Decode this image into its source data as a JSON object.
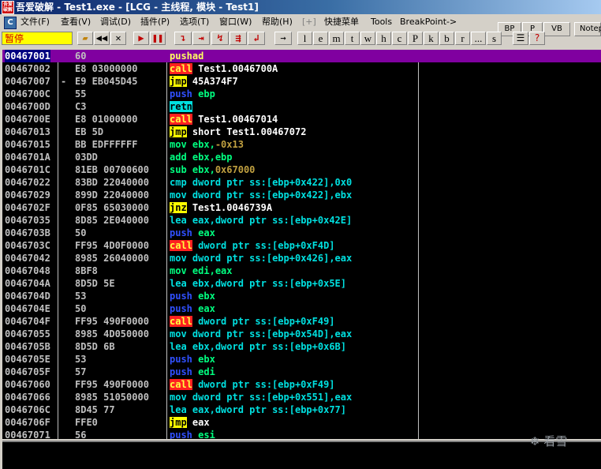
{
  "window": {
    "icon_text": "吾爱破解",
    "title": "吾爱破解 - Test1.exe - [LCG - 主线程, 模块 - Test1]"
  },
  "menu": [
    "文件(F)",
    "查看(V)",
    "调试(D)",
    "插件(P)",
    "选项(T)",
    "窗口(W)",
    "帮助(H)",
    "[+]",
    "快捷菜单",
    "Tools",
    "BreakPoint->"
  ],
  "right_buttons": [
    "BP",
    "P",
    "VB",
    "Notep"
  ],
  "status": "暂停",
  "toolbar_letters": [
    "l",
    "e",
    "m",
    "t",
    "w",
    "h",
    "c",
    "P",
    "k",
    "b",
    "r",
    "...",
    "s"
  ],
  "disasm": [
    {
      "addr": "00467001",
      "marker": "",
      "hex": "60",
      "mn": "pushad",
      "kind": "pushad",
      "op": "",
      "opkind": ""
    },
    {
      "addr": "00467002",
      "marker": "",
      "hex": "E8 03000000",
      "mn": "call",
      "kind": "call",
      "op": "Test1.0046700A",
      "opkind": "w"
    },
    {
      "addr": "00467007",
      "marker": "-",
      "hex": "E9 EB045D45",
      "mn": "jmp",
      "kind": "jmp",
      "op": "45A374F7",
      "opkind": "w"
    },
    {
      "addr": "0046700C",
      "marker": "",
      "hex": "55",
      "mn": "push",
      "kind": "push",
      "op": "ebp",
      "opkind": "c"
    },
    {
      "addr": "0046700D",
      "marker": "",
      "hex": "C3",
      "mn": "retn",
      "kind": "retn",
      "op": "",
      "opkind": ""
    },
    {
      "addr": "0046700E",
      "marker": "",
      "hex": "E8 01000000",
      "mn": "call",
      "kind": "call",
      "op": "Test1.00467014",
      "opkind": "w"
    },
    {
      "addr": "00467013",
      "marker": "",
      "hex": "EB 5D",
      "mn": "jmp",
      "kind": "jmp",
      "op": "short Test1.00467072",
      "opkind": "w"
    },
    {
      "addr": "00467015",
      "marker": "",
      "hex": "BB EDFFFFFF",
      "mn": "mov",
      "kind": "plain",
      "op": "ebx,-0x13",
      "opkind": "mix",
      "op1": "ebx,",
      "op2": "-0x13"
    },
    {
      "addr": "0046701A",
      "marker": "",
      "hex": "03DD",
      "mn": "add",
      "kind": "plain",
      "op": "ebx,ebp",
      "opkind": "c"
    },
    {
      "addr": "0046701C",
      "marker": "",
      "hex": "81EB 00700600",
      "mn": "sub",
      "kind": "plain",
      "op": "ebx,0x67000",
      "opkind": "mix",
      "op1": "ebx,",
      "op2": "0x67000"
    },
    {
      "addr": "00467022",
      "marker": "",
      "hex": "83BD 22040000",
      "mn": "cmp",
      "kind": "lea",
      "op": "dword ptr ss:[ebp+0x422],0x0",
      "opkind": "cy"
    },
    {
      "addr": "00467029",
      "marker": "",
      "hex": "899D 22040000",
      "mn": "mov",
      "kind": "lea",
      "op": "dword ptr ss:[ebp+0x422],ebx",
      "opkind": "cy"
    },
    {
      "addr": "0046702F",
      "marker": "",
      "hex": "0F85 65030000",
      "mn": "jnz",
      "kind": "jmp",
      "op": "Test1.0046739A",
      "opkind": "w"
    },
    {
      "addr": "00467035",
      "marker": "",
      "hex": "8D85 2E040000",
      "mn": "lea",
      "kind": "lea",
      "op": "eax,dword ptr ss:[ebp+0x42E]",
      "opkind": "cy"
    },
    {
      "addr": "0046703B",
      "marker": "",
      "hex": "50",
      "mn": "push",
      "kind": "push",
      "op": "eax",
      "opkind": "c"
    },
    {
      "addr": "0046703C",
      "marker": "",
      "hex": "FF95 4D0F0000",
      "mn": "call",
      "kind": "call",
      "op": "dword ptr ss:[ebp+0xF4D]",
      "opkind": "cy"
    },
    {
      "addr": "00467042",
      "marker": "",
      "hex": "8985 26040000",
      "mn": "mov",
      "kind": "lea",
      "op": "dword ptr ss:[ebp+0x426],eax",
      "opkind": "cy"
    },
    {
      "addr": "00467048",
      "marker": "",
      "hex": "8BF8",
      "mn": "mov",
      "kind": "plain",
      "op": "edi,eax",
      "opkind": "c"
    },
    {
      "addr": "0046704A",
      "marker": "",
      "hex": "8D5D 5E",
      "mn": "lea",
      "kind": "lea",
      "op": "ebx,dword ptr ss:[ebp+0x5E]",
      "opkind": "cy"
    },
    {
      "addr": "0046704D",
      "marker": "",
      "hex": "53",
      "mn": "push",
      "kind": "push",
      "op": "ebx",
      "opkind": "c"
    },
    {
      "addr": "0046704E",
      "marker": "",
      "hex": "50",
      "mn": "push",
      "kind": "push",
      "op": "eax",
      "opkind": "c"
    },
    {
      "addr": "0046704F",
      "marker": "",
      "hex": "FF95 490F0000",
      "mn": "call",
      "kind": "call",
      "op": "dword ptr ss:[ebp+0xF49]",
      "opkind": "cy"
    },
    {
      "addr": "00467055",
      "marker": "",
      "hex": "8985 4D050000",
      "mn": "mov",
      "kind": "lea",
      "op": "dword ptr ss:[ebp+0x54D],eax",
      "opkind": "cy"
    },
    {
      "addr": "0046705B",
      "marker": "",
      "hex": "8D5D 6B",
      "mn": "lea",
      "kind": "lea",
      "op": "ebx,dword ptr ss:[ebp+0x6B]",
      "opkind": "cy"
    },
    {
      "addr": "0046705E",
      "marker": "",
      "hex": "53",
      "mn": "push",
      "kind": "push",
      "op": "ebx",
      "opkind": "c"
    },
    {
      "addr": "0046705F",
      "marker": "",
      "hex": "57",
      "mn": "push",
      "kind": "push",
      "op": "edi",
      "opkind": "c"
    },
    {
      "addr": "00467060",
      "marker": "",
      "hex": "FF95 490F0000",
      "mn": "call",
      "kind": "call",
      "op": "dword ptr ss:[ebp+0xF49]",
      "opkind": "cy"
    },
    {
      "addr": "00467066",
      "marker": "",
      "hex": "8985 51050000",
      "mn": "mov",
      "kind": "lea",
      "op": "dword ptr ss:[ebp+0x551],eax",
      "opkind": "cy"
    },
    {
      "addr": "0046706C",
      "marker": "",
      "hex": "8D45 77",
      "mn": "lea",
      "kind": "lea",
      "op": "eax,dword ptr ss:[ebp+0x77]",
      "opkind": "cy"
    },
    {
      "addr": "0046706F",
      "marker": "",
      "hex": "FFE0",
      "mn": "jmp",
      "kind": "jmp",
      "op": "eax",
      "opkind": "w"
    },
    {
      "addr": "00467071",
      "marker": "",
      "hex": "56",
      "mn": "push",
      "kind": "push",
      "op": "esi",
      "opkind": "c"
    }
  ],
  "watermark": "❄ 看雪"
}
